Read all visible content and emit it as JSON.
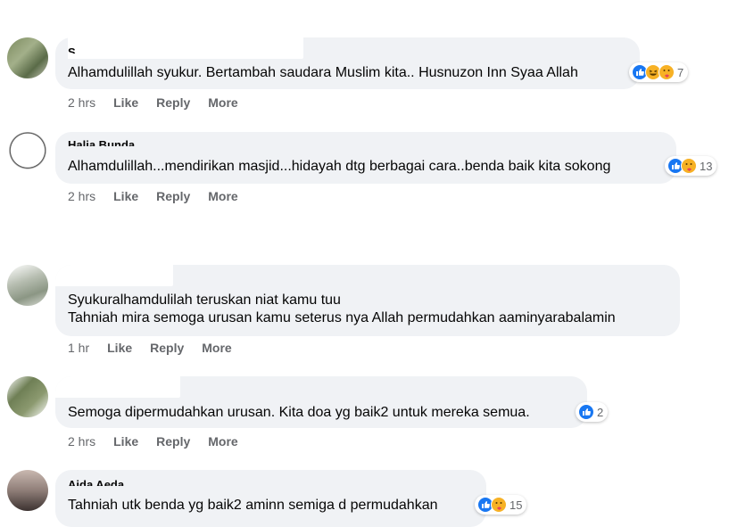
{
  "comments": [
    {
      "name": "S",
      "lines": [
        "Alhamdulillah syukur. Bertambah saudara Muslim kita.. Husnuzon Inn Syaa Allah"
      ],
      "reactions": [
        "like",
        "haha",
        "care"
      ],
      "reaction_count": "7",
      "time": "2 hrs",
      "like": "Like",
      "reply": "Reply",
      "more": "More"
    },
    {
      "name": "Halia Bunda",
      "lines": [
        "Alhamdulillah...mendirikan masjid...hidayah dtg berbagai cara..benda baik kita sokong"
      ],
      "reactions": [
        "like",
        "care"
      ],
      "reaction_count": "13",
      "time": "2 hrs",
      "like": "Like",
      "reply": "Reply",
      "more": "More"
    },
    {
      "name": "",
      "lines": [
        "Syukuralhamdulilah teruskan niat kamu tuu",
        "Tahniah mira semoga urusan kamu seterus nya Allah permudahkan aaminyarabalamin"
      ],
      "reactions": [],
      "reaction_count": "",
      "time": "1 hr",
      "like": "Like",
      "reply": "Reply",
      "more": "More"
    },
    {
      "name": "",
      "lines": [
        "Semoga dipermudahkan urusan. Kita doa yg baik2 untuk mereka semua."
      ],
      "reactions": [
        "like"
      ],
      "reaction_count": "2",
      "time": "2 hrs",
      "like": "Like",
      "reply": "Reply",
      "more": "More"
    },
    {
      "name": "Aida Aeda",
      "lines": [
        "Tahniah utk benda yg baik2 aminn semiga d permudahkan"
      ],
      "reactions": [
        "like",
        "care"
      ],
      "reaction_count": "15",
      "time": "",
      "like": "",
      "reply": "",
      "more": ""
    }
  ],
  "colors": {
    "bubble": "#f0f2f5",
    "secondary_text": "#65676b",
    "like_blue": "#1877f2",
    "emoji_yellow": "#f7b125"
  },
  "icons": [
    "avatar-photo",
    "like-reaction-icon",
    "haha-reaction-icon",
    "care-reaction-icon"
  ]
}
